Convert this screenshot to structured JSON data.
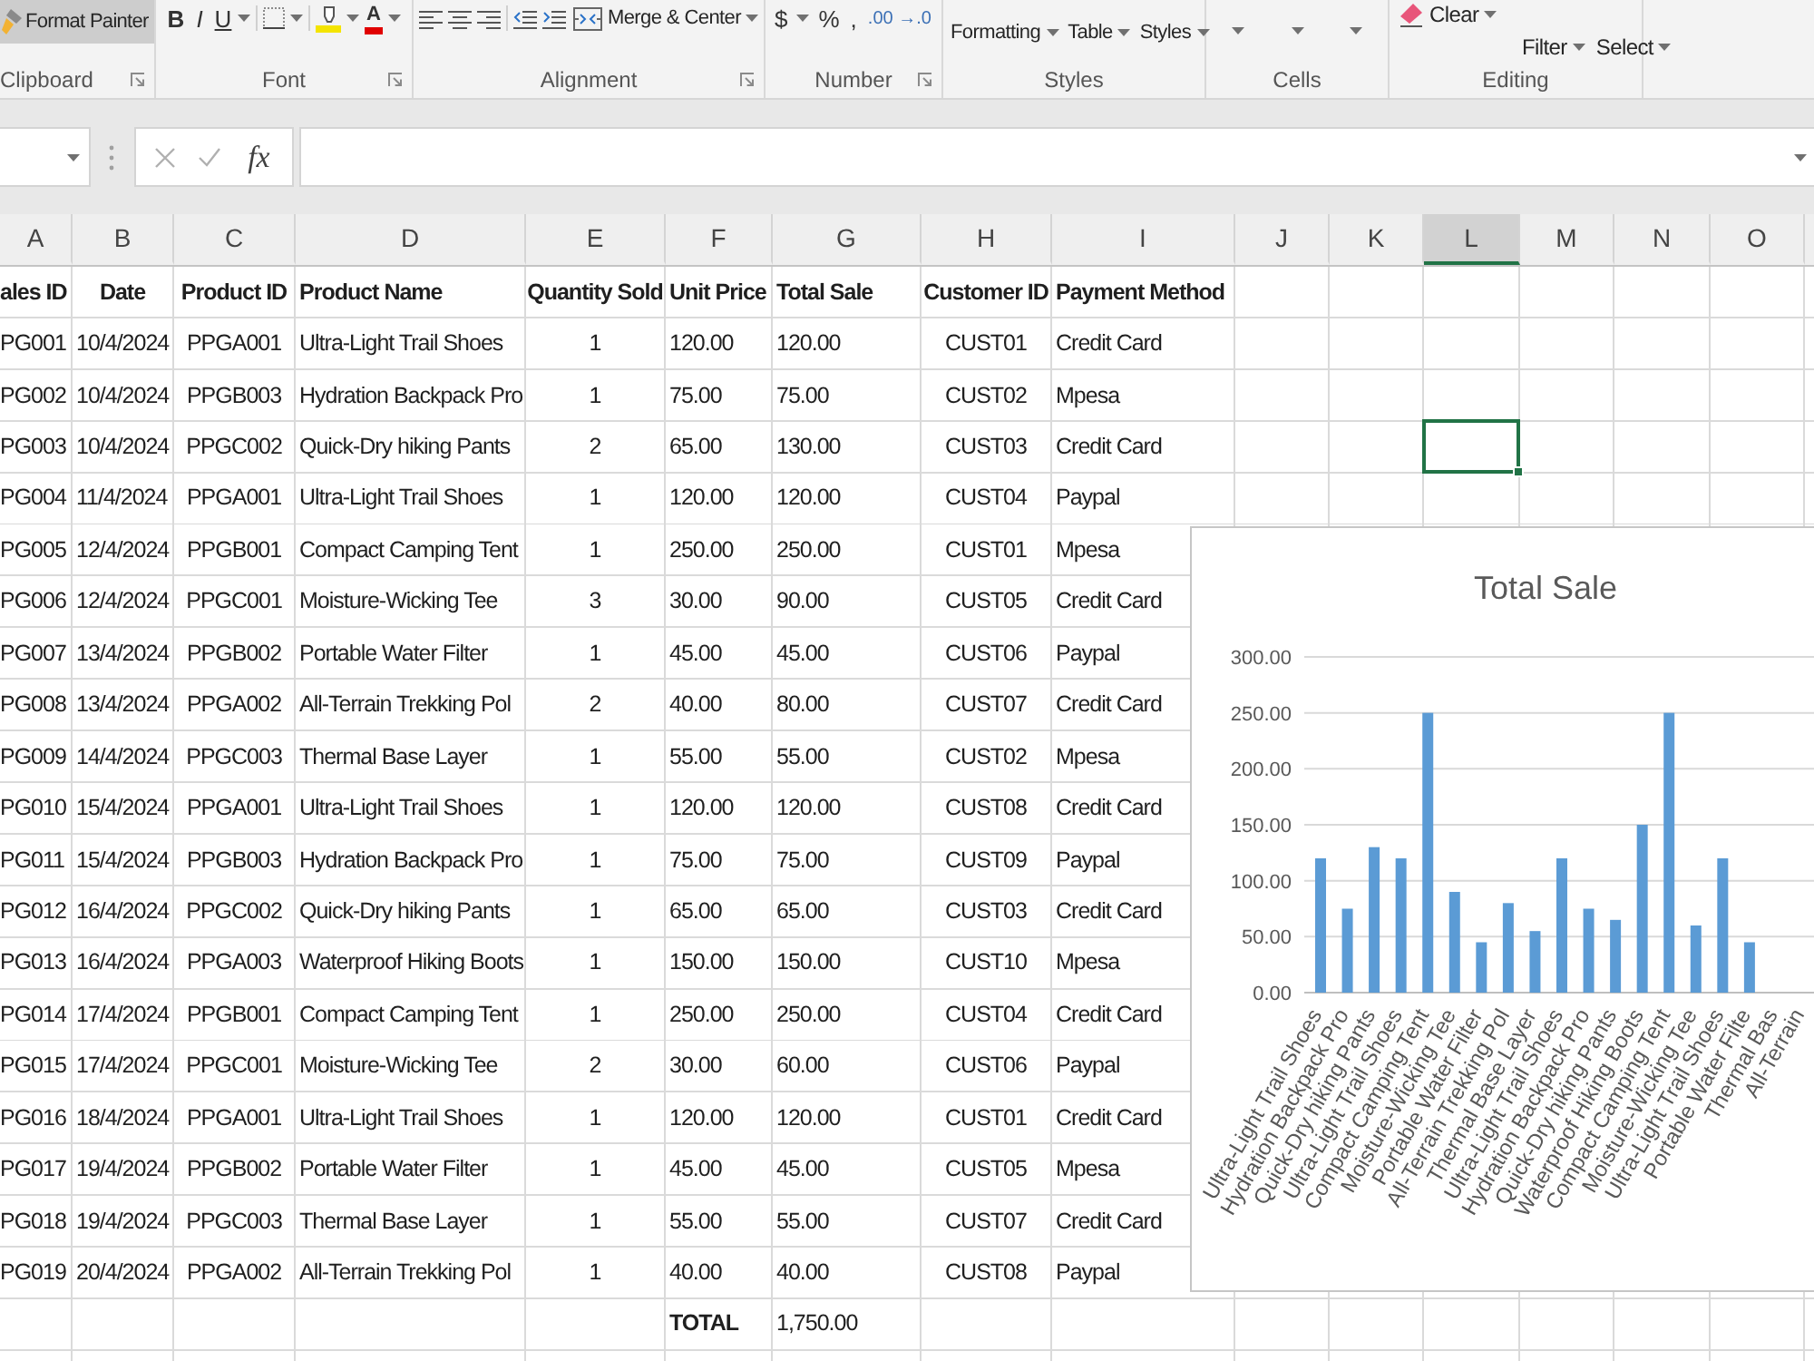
{
  "ribbon": {
    "clipboard": {
      "format_painter": {
        "label": "Format Painter",
        "pressed": true
      },
      "group_label": "Clipboard"
    },
    "font": {
      "style_buttons": [
        "B",
        "I",
        "U"
      ],
      "font_color": "A",
      "group_label": "Font"
    },
    "alignment": {
      "merge_label": "Merge & Center",
      "group_label": "Alignment"
    },
    "number": {
      "symbols": [
        "$",
        "%",
        ","
      ],
      "decimal_label": ".00 →.0",
      "group_label": "Number"
    },
    "styles": {
      "dropdowns": [
        "Formatting",
        "Table",
        "Styles"
      ],
      "group_label": "Styles"
    },
    "cells": {
      "group_label": "Cells"
    },
    "editing": {
      "clear_label": "Clear",
      "dropdowns": [
        "Filter",
        "Select"
      ],
      "group_label": "Editing"
    }
  },
  "formula_bar": {
    "buttons": [
      {
        "kind": "cancel",
        "disabled": true
      },
      {
        "kind": "enter",
        "disabled": true
      },
      {
        "kind": "function",
        "label": "fx",
        "disabled": false
      }
    ]
  },
  "sheet": {
    "columns": [
      {
        "label": "A",
        "selected": false
      },
      {
        "label": "B",
        "selected": false
      },
      {
        "label": "C",
        "selected": false
      },
      {
        "label": "D",
        "selected": false
      },
      {
        "label": "E",
        "selected": false
      },
      {
        "label": "F",
        "selected": false
      },
      {
        "label": "G",
        "selected": false
      },
      {
        "label": "H",
        "selected": false
      },
      {
        "label": "I",
        "selected": false
      },
      {
        "label": "J",
        "selected": false
      },
      {
        "label": "K",
        "selected": false
      },
      {
        "label": "L",
        "selected": true
      },
      {
        "label": "M",
        "selected": false
      },
      {
        "label": "N",
        "selected": false
      },
      {
        "label": "O",
        "selected": false
      }
    ],
    "header": [
      "ales ID",
      "Date",
      "Product ID",
      "Product Name",
      "Quantity Sold",
      "Unit Price",
      "Total Sale",
      "Customer ID",
      "Payment Method"
    ],
    "rows": [
      {
        "cells": [
          "PG001",
          "10/4/2024",
          "PPGA001",
          "Ultra-Light Trail Shoes",
          "1",
          "120.00",
          "120.00",
          "CUST01",
          "Credit Card"
        ],
        "selected": false
      },
      {
        "cells": [
          "PG002",
          "10/4/2024",
          "PPGB003",
          "Hydration Backpack Pro",
          "1",
          "75.00",
          "75.00",
          "CUST02",
          "Mpesa"
        ],
        "selected": false
      },
      {
        "cells": [
          "PG003",
          "10/4/2024",
          "PPGC002",
          "Quick-Dry hiking Pants",
          "2",
          "65.00",
          "130.00",
          "CUST03",
          "Credit Card"
        ],
        "selected": true
      },
      {
        "cells": [
          "PG004",
          "11/4/2024",
          "PPGA001",
          "Ultra-Light Trail Shoes",
          "1",
          "120.00",
          "120.00",
          "CUST04",
          "Paypal"
        ],
        "selected": false
      },
      {
        "cells": [
          "PG005",
          "12/4/2024",
          "PPGB001",
          "Compact Camping Tent",
          "1",
          "250.00",
          "250.00",
          "CUST01",
          "Mpesa"
        ],
        "selected": false
      },
      {
        "cells": [
          "PG006",
          "12/4/2024",
          "PPGC001",
          "Moisture-Wicking Tee",
          "3",
          "30.00",
          "90.00",
          "CUST05",
          "Credit Card"
        ],
        "selected": false
      },
      {
        "cells": [
          "PG007",
          "13/4/2024",
          "PPGB002",
          "Portable Water Filter",
          "1",
          "45.00",
          "45.00",
          "CUST06",
          "Paypal"
        ],
        "selected": false
      },
      {
        "cells": [
          "PG008",
          "13/4/2024",
          "PPGA002",
          "All-Terrain Trekking Pol",
          "2",
          "40.00",
          "80.00",
          "CUST07",
          "Credit Card"
        ],
        "selected": false
      },
      {
        "cells": [
          "PG009",
          "14/4/2024",
          "PPGC003",
          "Thermal Base Layer",
          "1",
          "55.00",
          "55.00",
          "CUST02",
          "Mpesa"
        ],
        "selected": false
      },
      {
        "cells": [
          "PG010",
          "15/4/2024",
          "PPGA001",
          "Ultra-Light Trail Shoes",
          "1",
          "120.00",
          "120.00",
          "CUST08",
          "Credit Card"
        ],
        "selected": false
      },
      {
        "cells": [
          "PG011",
          "15/4/2024",
          "PPGB003",
          "Hydration Backpack Pro",
          "1",
          "75.00",
          "75.00",
          "CUST09",
          "Paypal"
        ],
        "selected": false
      },
      {
        "cells": [
          "PG012",
          "16/4/2024",
          "PPGC002",
          "Quick-Dry hiking Pants",
          "1",
          "65.00",
          "65.00",
          "CUST03",
          "Credit Card"
        ],
        "selected": false
      },
      {
        "cells": [
          "PG013",
          "16/4/2024",
          "PPGA003",
          "Waterproof Hiking Boots",
          "1",
          "150.00",
          "150.00",
          "CUST10",
          "Mpesa"
        ],
        "selected": false
      },
      {
        "cells": [
          "PG014",
          "17/4/2024",
          "PPGB001",
          "Compact Camping Tent",
          "1",
          "250.00",
          "250.00",
          "CUST04",
          "Credit Card"
        ],
        "selected": false
      },
      {
        "cells": [
          "PG015",
          "17/4/2024",
          "PPGC001",
          "Moisture-Wicking Tee",
          "2",
          "30.00",
          "60.00",
          "CUST06",
          "Paypal"
        ],
        "selected": false
      },
      {
        "cells": [
          "PG016",
          "18/4/2024",
          "PPGA001",
          "Ultra-Light Trail Shoes",
          "1",
          "120.00",
          "120.00",
          "CUST01",
          "Credit Card"
        ],
        "selected": false
      },
      {
        "cells": [
          "PG017",
          "19/4/2024",
          "PPGB002",
          "Portable Water Filter",
          "1",
          "45.00",
          "45.00",
          "CUST05",
          "Mpesa"
        ],
        "selected": false
      },
      {
        "cells": [
          "PG018",
          "19/4/2024",
          "PPGC003",
          "Thermal Base Layer",
          "1",
          "55.00",
          "55.00",
          "CUST07",
          "Credit Card"
        ],
        "selected": false
      },
      {
        "cells": [
          "PG019",
          "20/4/2024",
          "PPGA002",
          "All-Terrain Trekking Pol",
          "1",
          "40.00",
          "40.00",
          "CUST08",
          "Paypal"
        ],
        "selected": false
      }
    ],
    "total_row": {
      "label": "TOTAL",
      "value": "1,750.00"
    }
  },
  "chart": {
    "chart_data": {
      "type": "bar",
      "title": "Total Sale",
      "categories": [
        "Ultra-Light Trail Shoes",
        "Hydration Backpack Pro",
        "Quick-Dry hiking Pants",
        "Ultra-Light Trail Shoes",
        "Compact Camping Tent",
        "Moisture-Wicking Tee",
        "Portable Water Filter",
        "All-Terrain Trekking Pol",
        "Thermal Base Layer",
        "Ultra-Light Trail Shoes",
        "Hydration Backpack Pro",
        "Quick-Dry hiking Pants",
        "Waterproof Hiking Boots",
        "Compact Camping Tent",
        "Moisture-Wicking Tee",
        "Ultra-Light Trail Shoes",
        "Portable Water Filte",
        "Thermal Bas",
        "All-Terrain"
      ],
      "values": [
        120,
        75,
        130,
        120,
        250,
        90,
        45,
        80,
        55,
        120,
        75,
        65,
        150,
        250,
        60,
        120,
        45,
        null,
        null
      ],
      "ylim": [
        0,
        300
      ],
      "yticks": [
        {
          "value": 0,
          "label": "0.00"
        },
        {
          "value": 50,
          "label": "50.00"
        },
        {
          "value": 100,
          "label": "100.00"
        },
        {
          "value": 150,
          "label": "150.00"
        },
        {
          "value": 200,
          "label": "200.00"
        },
        {
          "value": 250,
          "label": "250.00"
        },
        {
          "value": 300,
          "label": "300.00"
        }
      ],
      "grid": true
    }
  }
}
